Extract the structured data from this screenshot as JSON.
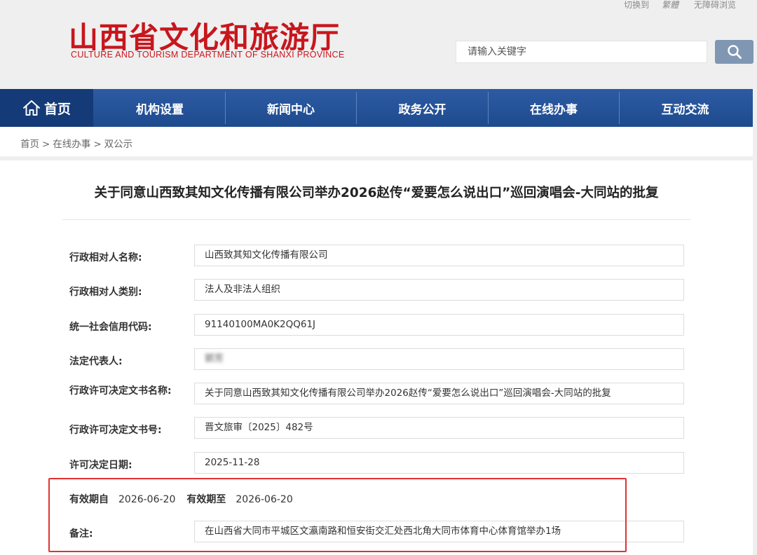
{
  "top_links": {
    "switch": "切换到",
    "switch_italic": "繁體",
    "accessible": "无障碍浏览"
  },
  "logo": {
    "cn": "山西省文化和旅游厅",
    "en": "CULTURE AND TOURISM DEPARTMENT OF SHANXI PROVINCE"
  },
  "search": {
    "placeholder": "请输入关键字"
  },
  "nav": {
    "home": "首页",
    "items": [
      "机构设置",
      "新闻中心",
      "政务公开",
      "在线办事",
      "互动交流"
    ]
  },
  "breadcrumb": {
    "items": [
      "首页",
      "在线办事",
      "双公示"
    ],
    "sep": ">"
  },
  "document": {
    "title": "关于同意山西致其知文化传播有限公司举办2026赵传“爱要怎么说出口”巡回演唱会-大同站的批复",
    "fields": [
      {
        "label": "行政相对人名称:",
        "value": "山西致其知文化传播有限公司"
      },
      {
        "label": "行政相对人类别:",
        "value": "法人及非法人组织"
      },
      {
        "label": "统一社会信用代码:",
        "value": "91140100MA0K2QQ61J"
      },
      {
        "label": "法定代表人:",
        "value": "郭芳"
      },
      {
        "label": "行政许可决定文书名称:",
        "value": "关于同意山西致其知文化传播有限公司举办2026赵传“爱要怎么说出口”巡回演唱会-大同站的批复"
      },
      {
        "label": "行政许可决定文书号:",
        "value": "晋文旅审〔2025〕482号"
      },
      {
        "label": "许可决定日期:",
        "value": "2025-11-28"
      }
    ],
    "valid_from_label": "有效期自",
    "valid_from": "2026-06-20",
    "valid_to_label": "有效期至",
    "valid_to": "2026-06-20",
    "remark_label": "备注:",
    "remark": "在山西省大同市平城区文瀛南路和恒安街交汇处西北角大同市体育中心体育馆举办1场"
  }
}
